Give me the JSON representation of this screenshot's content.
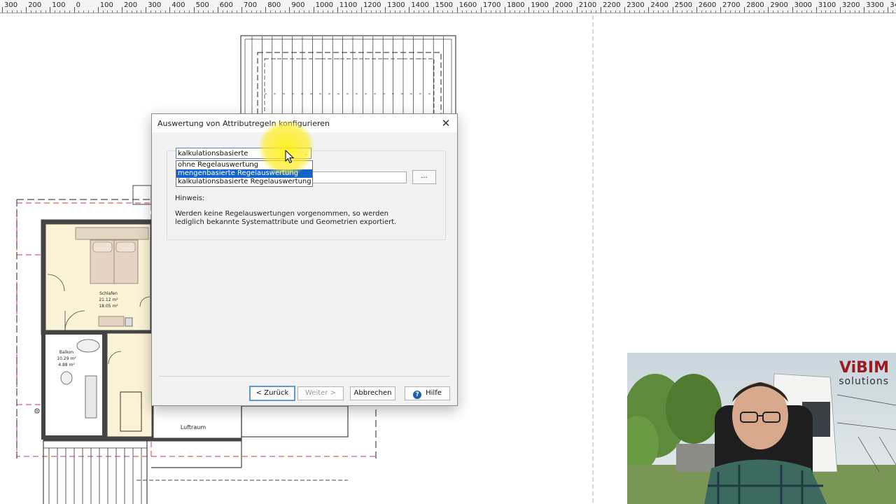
{
  "ruler": {
    "labels": [
      "300",
      "200",
      "100",
      "0",
      "100",
      "200",
      "300",
      "400",
      "500",
      "600",
      "700",
      "800",
      "900",
      "1000",
      "1100",
      "1200",
      "1300",
      "1400",
      "1500",
      "1600",
      "1700",
      "1800",
      "1900",
      "2000",
      "2100",
      "2200",
      "2300",
      "2400",
      "2500",
      "2600",
      "2700",
      "2800",
      "2900",
      "3000",
      "3100",
      "3200",
      "3300",
      "34"
    ]
  },
  "plan": {
    "room_bedroom": "Schlafen",
    "room_bedroom_area1": "21.12 m²",
    "room_bedroom_area2": "18.05 m²",
    "room_balcony": "Balkon",
    "room_balcony_area1": "10.29 m²",
    "room_balcony_area2": "4.88 m²",
    "room_void": "Luftraum"
  },
  "dialog": {
    "title": "Auswertung von Attributregeln konfigurieren",
    "combo_value": "kalkulationsbasierte Regelauswertung",
    "options": [
      "ohne Regelauswertung",
      "mengenbasierte Regelauswertung",
      "kalkulationsbasierte Regelauswertung"
    ],
    "browse_label": "...",
    "hint_label": "Hinweis:",
    "hint_text": "Werden keine Regelauswertungen vorgenommen, so werden lediglich bekannte Systemattribute und Geometrien exportiert.",
    "back_label": "< Zurück",
    "next_label": "Weiter >",
    "cancel_label": "Abbrechen",
    "help_label": "Hilfe"
  },
  "logo": {
    "brand_a": "Vi",
    "brand_b": "BIM",
    "tagline": "solutions"
  }
}
